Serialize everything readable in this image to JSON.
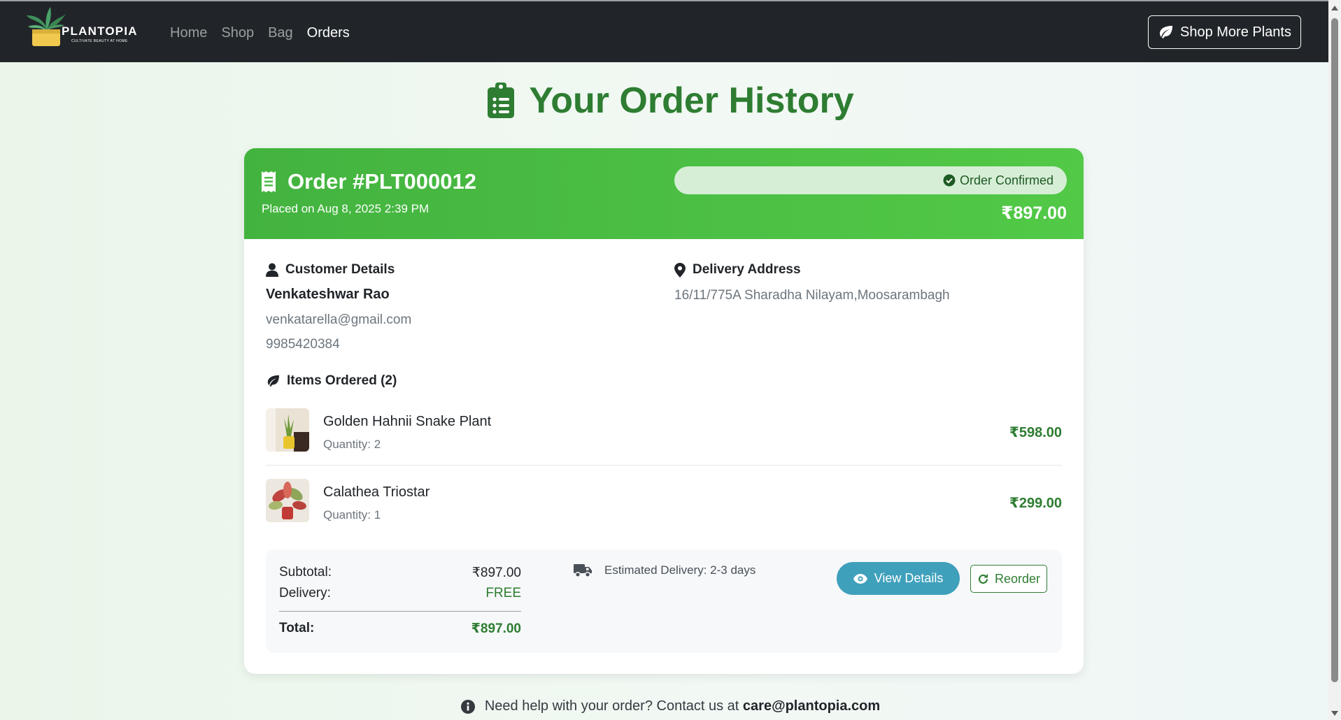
{
  "nav": {
    "brand": "PLANTOPIA",
    "tagline": "CULTIVATE BEAUTY AT HOME",
    "links": [
      "Home",
      "Shop",
      "Bag",
      "Orders"
    ],
    "active_link": "Orders",
    "shop_more_label": "Shop More Plants"
  },
  "page": {
    "title": "Your Order History",
    "help_prefix": "Need help with your order? Contact us at ",
    "help_email": "care@plantopia.com"
  },
  "order": {
    "title": "Order #PLT000012",
    "placed_on": "Placed on Aug 8, 2025 2:39 PM",
    "status": "Order Confirmed",
    "total": "₹897.00",
    "customer_heading": "Customer Details",
    "customer_name": "Venkateshwar Rao",
    "customer_email": "venkatarella@gmail.com",
    "customer_phone": "9985420384",
    "address_heading": "Delivery Address",
    "address": "16/11/775A Sharadha Nilayam,Moosarambagh",
    "items_heading": "Items Ordered (2)",
    "items": [
      {
        "name": "Golden Hahnii Snake Plant",
        "quantity": "Quantity: 2",
        "price": "₹598.00"
      },
      {
        "name": "Calathea Triostar",
        "quantity": "Quantity: 1",
        "price": "₹299.00"
      }
    ],
    "summary": {
      "subtotal_label": "Subtotal:",
      "subtotal_value": "₹897.00",
      "delivery_label": "Delivery:",
      "delivery_value": "FREE",
      "total_label": "Total:",
      "total_value": "₹897.00",
      "estimated_delivery": "Estimated Delivery: 2-3 days"
    },
    "view_details_label": "View Details",
    "reorder_label": "Reorder"
  },
  "colors": {
    "navbar": "#212529",
    "header_green": "#4cbb45",
    "title_green": "#2e7d32",
    "view_button": "#3fa0bc"
  }
}
